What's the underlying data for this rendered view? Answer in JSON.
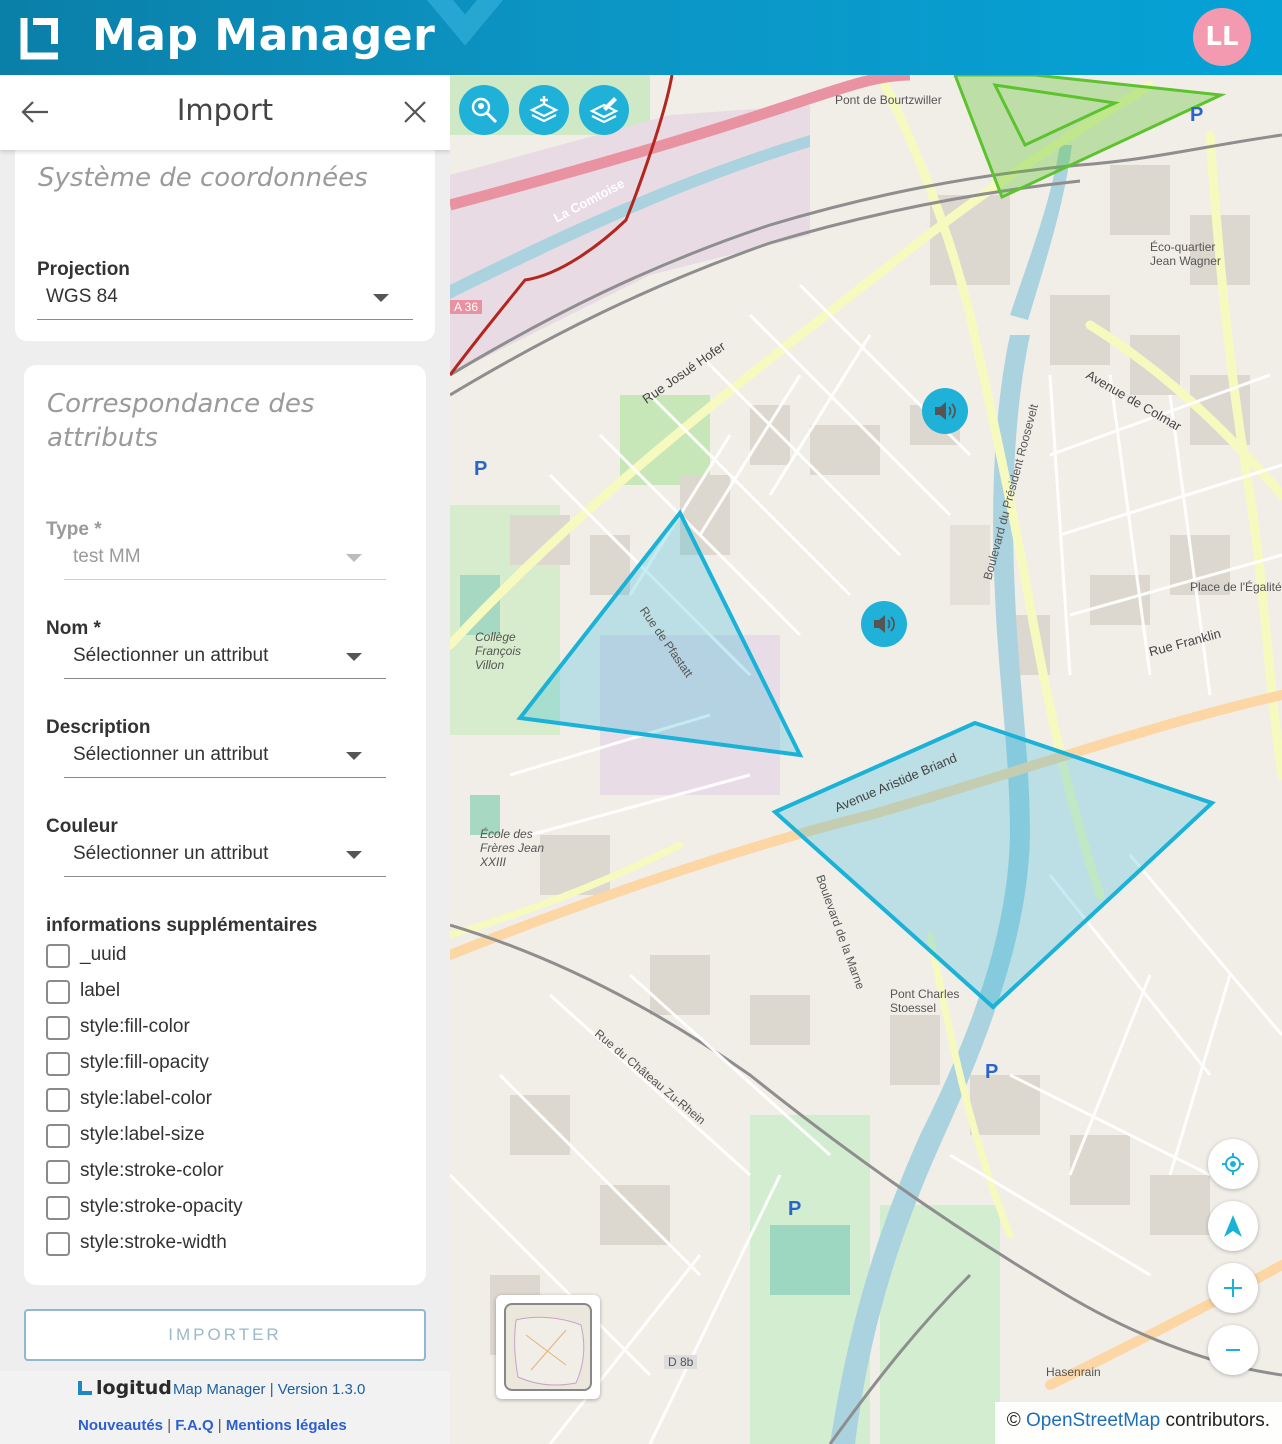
{
  "header": {
    "app_title": "Map Manager",
    "avatar_initials": "LL",
    "brand_color": "#0c95c4",
    "avatar_color": "#f49ab0"
  },
  "panel": {
    "title": "Import",
    "back_icon": "arrow-left-icon",
    "close_icon": "close-icon"
  },
  "coordinates": {
    "section_title": "Système de coordonnées",
    "projection_label": "Projection",
    "projection_value": "WGS 84"
  },
  "attributes": {
    "section_title_line1": "Correspondance des",
    "section_title_line2": "attributs",
    "type_label": "Type *",
    "type_value": "test MM",
    "name_label": "Nom *",
    "name_value": "Sélectionner un attribut",
    "description_label": "Description",
    "description_value": "Sélectionner un attribut",
    "color_label": "Couleur",
    "color_value": "Sélectionner un attribut",
    "extra_label": "informations supplémentaires",
    "extra_options": [
      "_uuid",
      "label",
      "style:fill-color",
      "style:fill-opacity",
      "style:label-color",
      "style:label-size",
      "style:stroke-color",
      "style:stroke-opacity",
      "style:stroke-width"
    ]
  },
  "import_button": "IMPORTER",
  "footer": {
    "brand": "logitud",
    "version": "Map Manager | Version 1.3.0",
    "link_news": "Nouveautés",
    "link_faq": "F.A.Q",
    "link_legal": "Mentions légales",
    "separator": "|"
  },
  "map": {
    "tools": [
      "search-location-icon",
      "add-layer-icon",
      "edit-layer-icon"
    ],
    "controls": [
      "locate-icon",
      "north-arrow-icon",
      "zoom-in-icon",
      "zoom-out-icon"
    ],
    "attribution_prefix": "©",
    "attribution_link": "OpenStreetMap",
    "attribution_suffix": "contributors.",
    "polygon_color": "#1bb2d8",
    "green_polygon_color": "#5cc22e",
    "labels": [
      "La Comtoise",
      "Pont de Bourtzwiller",
      "Rue Josué Hofer",
      "Avenue de Colmar",
      "Boulevard du Président Roosevelt",
      "Avenue Aristide Briand",
      "Rue Franklin",
      "Place de l'Égalité",
      "Éco-quartier Jean Wagner",
      "Collège François Villon",
      "École des Frères Jean XXIII",
      "Pont Charles Stoessel",
      "Rue de Pfastatt",
      "Boulevard de la Marne",
      "Rue du Château Zu-Rhein",
      "Hasenrain",
      "D 8b",
      "A 36"
    ]
  }
}
